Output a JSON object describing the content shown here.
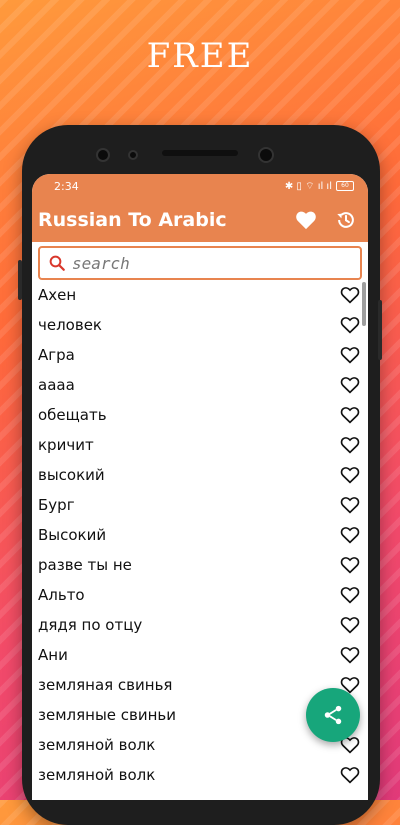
{
  "promo": {
    "title": "FREE"
  },
  "status_bar": {
    "time": "2:34",
    "icons": "✱ ▯ ⌔ ıl ıl",
    "battery": "60"
  },
  "app_bar": {
    "title": "Russian To Arabic",
    "favorites_icon": "heart-icon",
    "history_icon": "history-icon"
  },
  "search": {
    "placeholder": "search",
    "value": ""
  },
  "words": [
    "Ахен",
    "человек",
    "Агра",
    "аааа",
    "обещать",
    "кричит",
    "высокий",
    "Бург",
    "Высокий",
    "разве ты не",
    "Альто",
    "дядя по отцу",
    "Ани",
    "земляная свинья",
    "земляные свиньи",
    "земляной волк",
    "земляной волк"
  ],
  "fab": {
    "icon": "share-icon",
    "color": "#17a67b"
  },
  "colors": {
    "accent": "#e8844f"
  }
}
